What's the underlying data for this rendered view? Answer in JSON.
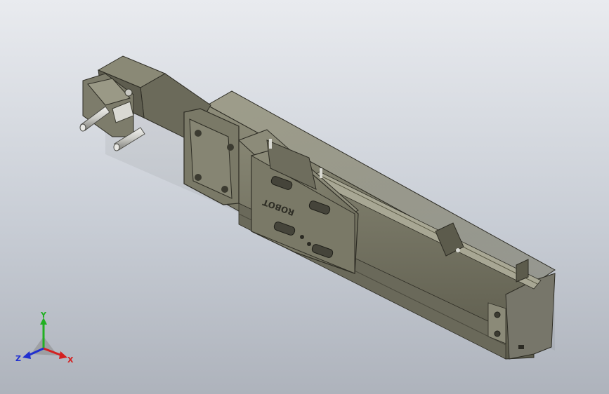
{
  "viewport": {
    "background_top": "#e9ebef",
    "background_bottom": "#aeb3bc"
  },
  "model": {
    "body_color": "#6d6c5c",
    "body_dark": "#3f3e33",
    "body_light": "#8f8e7c",
    "carriage_color": "#7a7968",
    "shaft_color": "#d4d4d0",
    "engraving": "ROBOT"
  },
  "triad": {
    "x_label": "X",
    "y_label": "Y",
    "z_label": "Z",
    "x_color": "#d42020",
    "y_color": "#22b022",
    "z_color": "#2030d0"
  }
}
